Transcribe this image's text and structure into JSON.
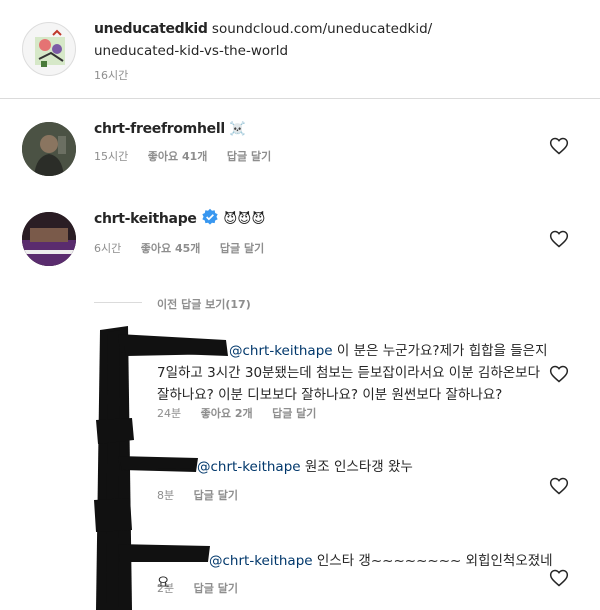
{
  "post": {
    "username": "uneducatedkid",
    "caption_line1": "soundcloud.com/uneducatedkid/",
    "caption_line2": "uneducated-kid-vs-the-world",
    "time": "16시간"
  },
  "comments": [
    {
      "username": "chrt-freefromhell",
      "emoji": "☠️",
      "time": "15시간",
      "likes": "좋아요 41개",
      "reply": "답글 달기"
    },
    {
      "username": "chrt-keithape",
      "emoji": "😈😈😈",
      "time": "6시간",
      "likes": "좋아요 45개",
      "reply": "답글 달기"
    }
  ],
  "view_replies": "이전 답글 보기(17)",
  "replies": [
    {
      "mention": "@chrt-keithape",
      "text_line1": " 이 분은 누군가요?제가 힙합을 들은지",
      "text_line2": "7일하고 3시간 30분됐는데 첨보는 듣보잡이라서요 이분 김하온보다",
      "text_line3": "잘하나요? 이분 디보보다 잘하나요? 이분 원썬보다 잘하나요?",
      "time": "24분",
      "likes": "좋아요 2개",
      "reply": "답글 달기"
    },
    {
      "mention": "@chrt-keithape",
      "text_line1": " 원조 인스타갱 왔누",
      "time": "8분",
      "reply": "답글 달기"
    },
    {
      "mention": "@chrt-keithape",
      "text_line1": " 인스타 갱~~~~~~~~ 외힙인척오졌네요",
      "time": "2분",
      "reply": "답글 달기"
    }
  ],
  "colors": {
    "text": "#262626",
    "meta": "#8e8e8e",
    "mention": "#00376b",
    "verified": "#3897f0",
    "redaction": "#111111"
  }
}
